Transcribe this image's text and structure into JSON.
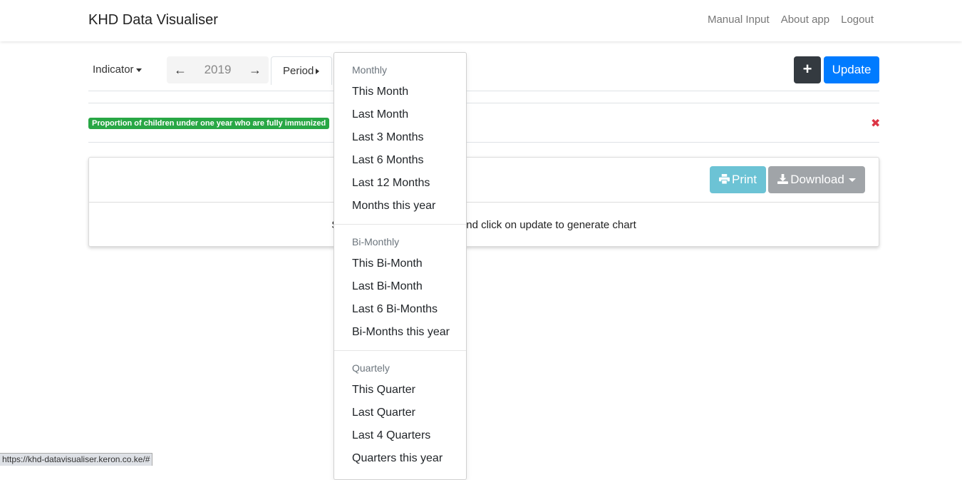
{
  "app": {
    "title": "KHD Data Visualiser"
  },
  "nav": {
    "links": [
      "Manual Input",
      "About app",
      "Logout"
    ]
  },
  "toolbar": {
    "indicator_label": "Indicator",
    "prev_arrow": "←",
    "year": "2019",
    "next_arrow": "→",
    "period_label": "Period",
    "plus_label": "+",
    "update_label": "Update"
  },
  "selected_indicator": {
    "label": "Proportion of children under one year who are fully immunized",
    "remove_icon": "✖"
  },
  "card": {
    "print_label": "Print",
    "download_label": "Download",
    "message_left": "S",
    "message_right": "nd click on update to generate chart"
  },
  "period_dropdown": {
    "groups": [
      {
        "header": "Monthly",
        "items": [
          "This Month",
          "Last Month",
          "Last 3 Months",
          "Last 6 Months",
          "Last 12 Months",
          "Months this year"
        ]
      },
      {
        "header": "Bi-Monthly",
        "items": [
          "This Bi-Month",
          "Last Bi-Month",
          "Last 6 Bi-Months",
          "Bi-Months this year"
        ]
      },
      {
        "header": "Quartely",
        "items": [
          "This Quarter",
          "Last Quarter",
          "Last 4 Quarters",
          "Quarters this year"
        ]
      }
    ]
  },
  "status_bar": {
    "url": "https://khd-datavisualiser.keron.co.ke/#"
  },
  "colors": {
    "primary": "#007bff",
    "dark": "#343a40",
    "info": "#6cc3d5",
    "secondary": "#a0a4a8",
    "success": "#28a745",
    "danger": "#dc3545"
  }
}
